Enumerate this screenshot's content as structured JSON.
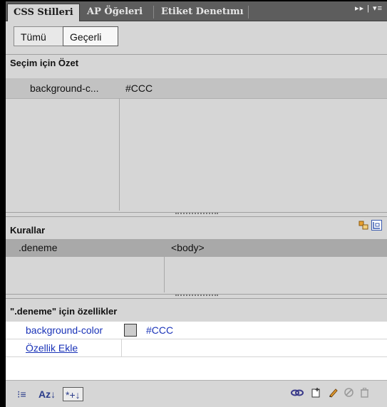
{
  "tabs": [
    {
      "label": "CSS Stilleri",
      "active": true
    },
    {
      "label": "AP Öğeleri",
      "active": false
    },
    {
      "label": "Etiket Denetımı",
      "active": false
    }
  ],
  "tabbar_menu": "▸▸ | ▾≡",
  "toggle": {
    "all_label": "Tümü",
    "current_label": "Geçerli",
    "selected": "current"
  },
  "summary": {
    "header": "Seçim için Özet",
    "rows": [
      {
        "property": "background-c...",
        "value": "#CCC"
      }
    ]
  },
  "rules": {
    "header": "Kurallar",
    "rows": [
      {
        "selector": ".deneme",
        "source": "<body>"
      }
    ]
  },
  "properties": {
    "header": "\".deneme\" için özellikler",
    "items": [
      {
        "name": "background-color",
        "value": "#CCC",
        "swatch_color": "#cccccc"
      }
    ],
    "add_label": "Özellik Ekle"
  },
  "footer": {
    "category_view_glyph": "⁝≡",
    "alpha_view_glyph": "Az↓",
    "set_props_glyph": "*+↓"
  },
  "colors": {
    "panel": "#d6d6d6",
    "tab_bg": "#5d5d5d",
    "selected_row": "#c2c2c2",
    "rule_row": "#a9a9a9",
    "link": "#1a33b8"
  }
}
